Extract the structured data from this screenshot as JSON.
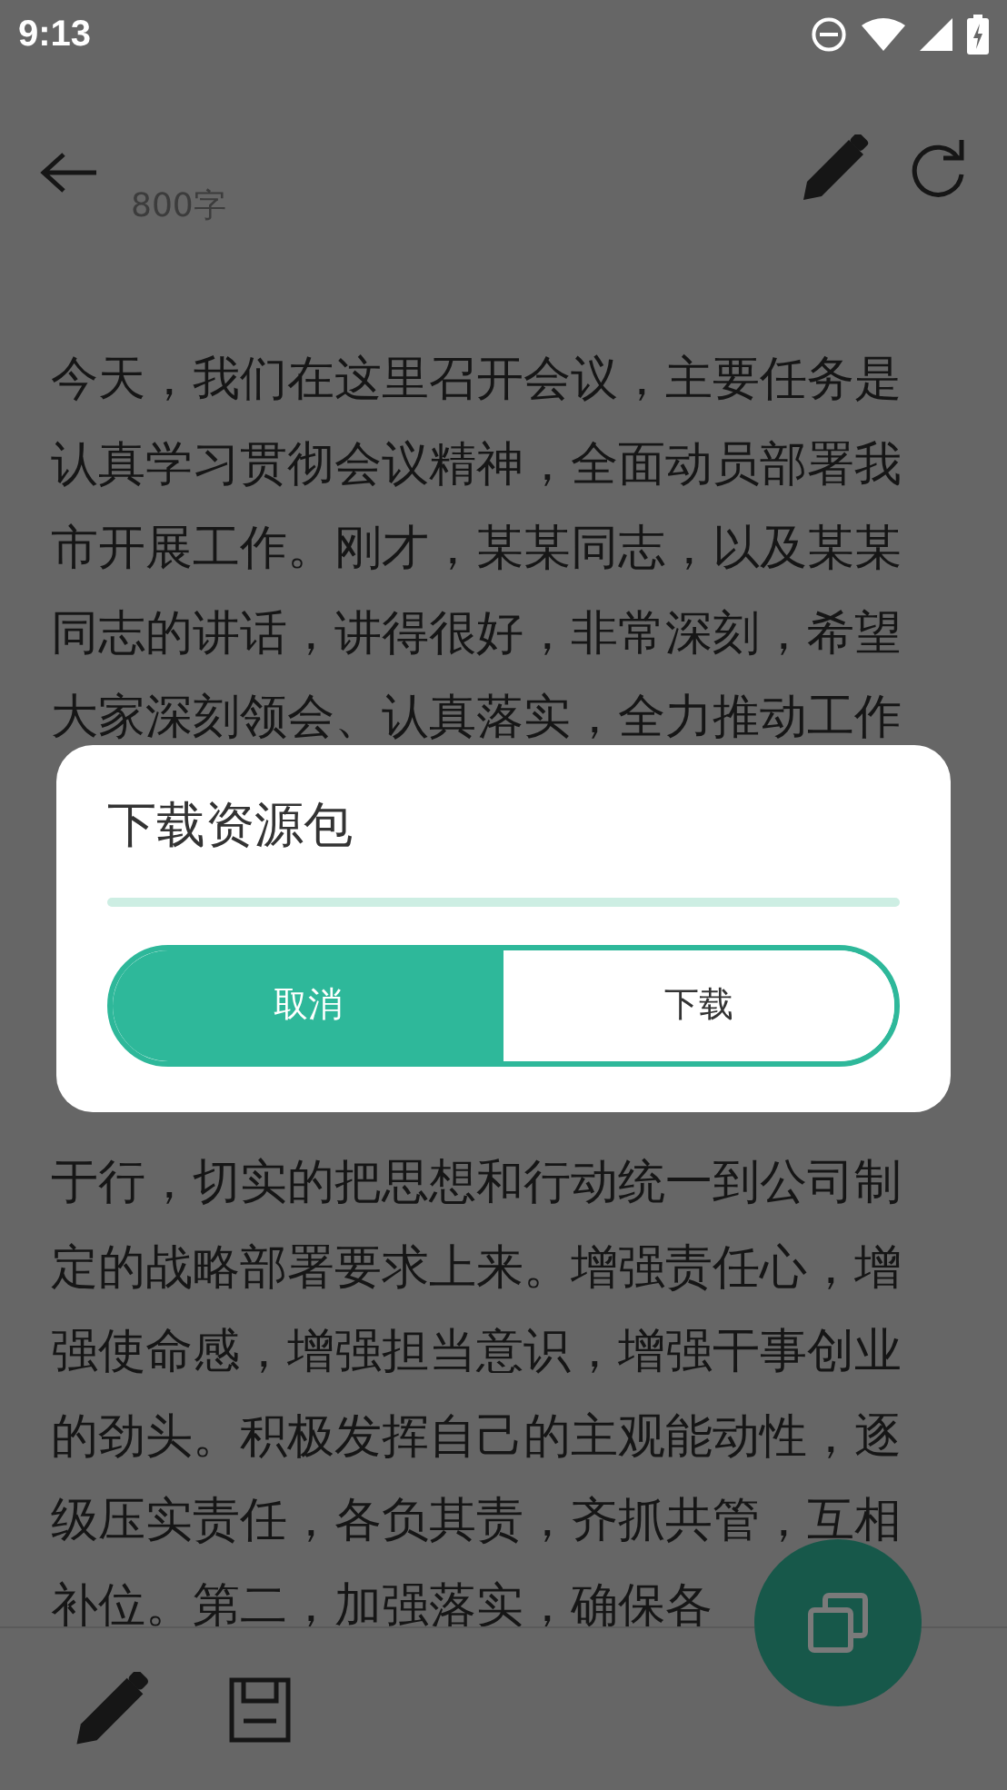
{
  "status_bar": {
    "time": "9:13"
  },
  "header": {
    "word_count": "800字"
  },
  "body": {
    "lines_top": [
      "今天，我们在这里召开会议，主要任务是",
      "认真学习贯彻会议精神，全面动员部署我",
      "市开展工作。刚才，某某同志，以及某某",
      "同志的讲话，讲得很好，非常深刻，希望",
      "大家深刻领会、认真落实，全力推动工作"
    ],
    "lines_bottom": [
      "于行，切实的把思想和行动统一到公司制",
      "定的战略部署要求上来。增强责任心，增",
      "强使命感，增强担当意识，增强干事创业",
      "的劲头。积极发挥自己的主观能动性，逐",
      "级压实责任，各负其责，齐抓共管，互相",
      "补位。第二，加强落实，确保各"
    ]
  },
  "dialog": {
    "title": "下载资源包",
    "progress": {
      "level": 0
    },
    "buttons": [
      {
        "label": "取消",
        "kind": "filled"
      },
      {
        "label": "下载",
        "kind": "outline"
      }
    ]
  }
}
